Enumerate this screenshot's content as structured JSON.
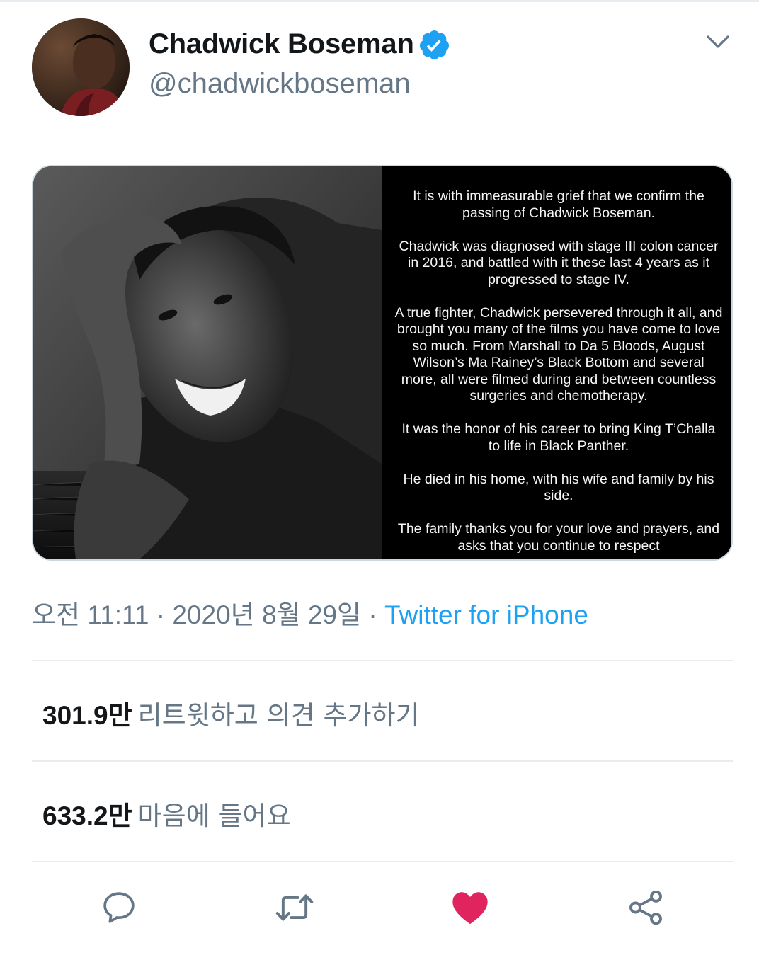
{
  "tweet": {
    "author": {
      "name": "Chadwick Boseman",
      "handle": "@chadwickboseman",
      "verified": true
    },
    "media": {
      "statement_paragraphs": [
        "It is with immeasurable grief that we confirm the passing of Chadwick Boseman.",
        "Chadwick was diagnosed with stage III colon cancer in 2016, and battled with it these last 4 years as it progressed to stage IV.",
        "A true fighter, Chadwick persevered through it all, and brought you many of the films you have come to love so much. From Marshall to Da 5 Bloods, August Wilson’s Ma Rainey’s Black Bottom and several more, all were filmed during and between countless surgeries and chemotherapy.",
        "It was the honor of his career to bring King T’Challa to life in Black Panther.",
        "He died in his home, with his wife and family by his side.",
        "The family thanks you for your love and prayers, and asks that you continue to respect"
      ]
    },
    "time": "오전 11:11",
    "separator": "·",
    "date": "2020년 8월 29일",
    "client": "Twitter for iPhone",
    "retweets": {
      "count": "301.9",
      "unit": "만",
      "label": "리트윗하고 의견 추가하기"
    },
    "likes": {
      "count": "633.2",
      "unit": "만",
      "label": "마음에 들어요"
    }
  },
  "colors": {
    "link": "#1da1f2",
    "secondary_text": "#657786",
    "like_active": "#e0245e",
    "verified": "#1da1f2"
  },
  "icons": {
    "reply": "reply-icon",
    "retweet": "retweet-icon",
    "like": "heart-icon",
    "share": "share-icon",
    "more": "chevron-down-icon"
  }
}
